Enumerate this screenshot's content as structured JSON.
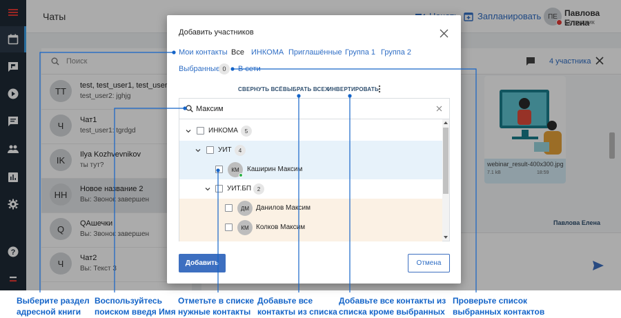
{
  "rail": {
    "icons": [
      "menu-icon",
      "calendar-icon",
      "chat-flag-icon",
      "play-icon",
      "message-icon",
      "people-icon",
      "chart-icon",
      "gear-icon",
      "help-icon",
      "minus-icon"
    ],
    "accent": "#e53935",
    "active_color": "#3aa0e8"
  },
  "header": {
    "title": "Чаты",
    "meet_label": "Начать",
    "schedule_label": "Запланировать",
    "user_initials": "ПЕ",
    "user_name": "Павлова Елена",
    "user_role": "Сотрудник"
  },
  "chatlist": {
    "search_placeholder": "Поиск",
    "items": [
      {
        "initials": "TT",
        "name": "test, test_user1, test_user2, u",
        "last": "test_user2: jghjg"
      },
      {
        "initials": "Ч",
        "name": "Чат1",
        "last": "test_user1: tgrdgd"
      },
      {
        "initials": "IK",
        "name": "Ilya Kozhvevnikov",
        "last": "ты тут?"
      },
      {
        "initials": "НН",
        "name": "Новое название 2",
        "last": "Вы: Звонок завершен"
      },
      {
        "initials": "Q",
        "name": "QАшечки",
        "last": "Вы: Звонок завершен"
      },
      {
        "initials": "Ч",
        "name": "Чат2",
        "last": "Вы: Текст 3"
      }
    ]
  },
  "chat": {
    "participants": "4 участника",
    "image_name": "webinar_result-400x300.jpg",
    "image_size": "7.1 kB",
    "image_time": "18:59",
    "author": "Павлова Елена"
  },
  "dialog": {
    "title": "Добавить участников",
    "tabs": [
      "Мои контакты",
      "Все",
      "ИНКОМА",
      "Приглашённые",
      "Группа 1",
      "Группа 2"
    ],
    "current_tab": "Все",
    "selected_label": "Выбранные",
    "selected_count": "0",
    "online_label": "В сети",
    "actions": {
      "collapse_all": "СВЕРНУТЬ ВСЁ",
      "select_all": "ВЫБРАТЬ ВСЕХ",
      "invert": "ИНВЕРТИРОВАТЬ"
    },
    "search_value": "Максим",
    "tree": [
      {
        "type": "group",
        "label": "ИНКОМА",
        "count": "5",
        "level": 0
      },
      {
        "type": "group",
        "label": "УИТ",
        "count": "4",
        "level": 1
      },
      {
        "type": "person",
        "label": "Каширин Максим",
        "initials": "КМ",
        "level": 2,
        "online": true
      },
      {
        "type": "group",
        "label": "УИТ.БП",
        "count": "2",
        "level": 2
      },
      {
        "type": "person",
        "label": "Данилов Максим",
        "initials": "ДМ",
        "level": 3,
        "online": false
      },
      {
        "type": "person",
        "label": "Колков Максим",
        "initials": "КМ",
        "level": 3,
        "online": false
      }
    ],
    "add_label": "Добавить",
    "cancel_label": "Отмена",
    "primary_color": "#3d6fc0"
  },
  "callouts": [
    {
      "text1": "Выберите раздел",
      "text2": "адресной книги"
    },
    {
      "text1": "Воспользуйтесь",
      "text2": "поиском введя Имя"
    },
    {
      "text1": "Отметьте в списке",
      "text2": "нужные контакты"
    },
    {
      "text1": "Добавьте все",
      "text2": "контакты из списка"
    },
    {
      "text1": "Добавьте все контакты из",
      "text2": "списка кроме выбранных"
    },
    {
      "text1": "Проверьте список",
      "text2": "выбранных контактов"
    }
  ],
  "callout_color": "#1464c8"
}
